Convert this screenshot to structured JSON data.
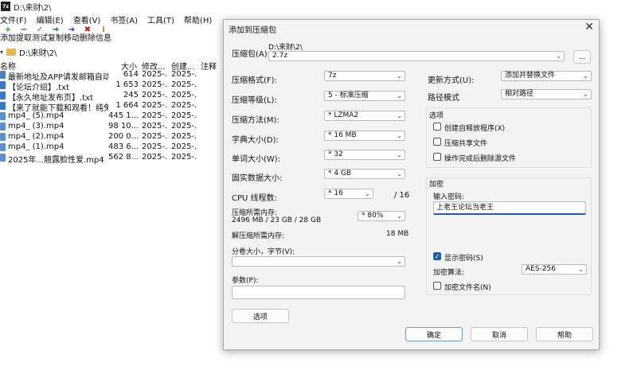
{
  "main": {
    "title": "D:\\来财\\2\\",
    "menu": [
      "文件(F)",
      "编辑(E)",
      "查看(V)",
      "书签(A)",
      "工具(T)",
      "帮助(H)"
    ],
    "toolbar": [
      {
        "label": "添加",
        "icon": "+",
        "color": "#1a9a1a"
      },
      {
        "label": "提取",
        "icon": "−",
        "color": "#1a3fb0"
      },
      {
        "label": "测试",
        "icon": "✓",
        "color": "#2a8fa8"
      },
      {
        "label": "复制",
        "icon": "➔",
        "color": "#1a6a3a"
      },
      {
        "label": "移动",
        "icon": "➔",
        "color": "#1a3fb0"
      },
      {
        "label": "删除",
        "icon": "✖",
        "color": "#c01a1a"
      },
      {
        "label": "信息",
        "icon": "i",
        "color": "#b88a00"
      }
    ],
    "address": "D:\\来财\\2\\",
    "columns": {
      "name": "名称",
      "size": "大小",
      "modified": "修改...",
      "created": "创建...",
      "comment": "注释"
    },
    "files": [
      {
        "name": "最新地址及APP请发邮箱自动...",
        "size": "614",
        "modified": "2025-...",
        "created": "2025-...",
        "type": "doc"
      },
      {
        "name": "【论坛介绍】.txt",
        "size": "1 653",
        "modified": "2025-...",
        "created": "2025-...",
        "type": "txt"
      },
      {
        "name": "【永久地址发布页】.txt",
        "size": "245",
        "modified": "2025-...",
        "created": "2025-...",
        "type": "txt"
      },
      {
        "name": "【来了就能下载和观看！纯免...",
        "size": "1 664",
        "modified": "2025-...",
        "created": "2025-...",
        "type": "txt"
      },
      {
        "name": "mp4_ (5).mp4",
        "size": "445 1...",
        "modified": "2025-...",
        "created": "2025-...",
        "type": "mp4"
      },
      {
        "name": "mp4_ (3).mp4",
        "size": "98 10...",
        "modified": "2025-...",
        "created": "2025-...",
        "type": "mp4"
      },
      {
        "name": "mp4_ (2).mp4",
        "size": "200 0...",
        "modified": "2025-...",
        "created": "2025-...",
        "type": "mp4"
      },
      {
        "name": "mp4_ (1).mp4",
        "size": "483 6...",
        "modified": "2025-...",
        "created": "2025-...",
        "type": "mp4"
      },
      {
        "name": "2025年...翘露脸性爱.mp4",
        "size": "562 8...",
        "modified": "2025-...",
        "created": "2025-...",
        "type": "mp4"
      }
    ]
  },
  "dialog": {
    "title": "添加到压缩包",
    "close": "✕",
    "archive_label": "压缩包(A):",
    "archive_path": "D:\\来财\\2\\",
    "archive_name": "2.7z",
    "browse": "...",
    "format_label": "压缩格式(F):",
    "format_value": "7z",
    "level_label": "压缩等级(L):",
    "level_value": "5 - 标准压缩",
    "method_label": "压缩方法(M):",
    "method_value": "*  LZMA2",
    "dict_label": "字典大小(D):",
    "dict_value": "*  16 MB",
    "word_label": "单词大小(W):",
    "word_value": "*  32",
    "solid_label": "固实数据大小:",
    "solid_value": "*  4 GB",
    "cpu_label": "CPU 线程数:",
    "cpu_value": "*  16",
    "cpu_total": "/ 16",
    "mem_label": "压缩所需内存:",
    "mem_detail": "2496 MB / 23 GB / 28 GB",
    "mem_percent": "* 80%",
    "demem_label": "解压缩所需内存:",
    "demem_value": "18 MB",
    "split_label": "分卷大小，字节(V):",
    "split_value": "",
    "params_label": "参数(P):",
    "params_value": "",
    "options_button": "选项",
    "update_label": "更新方式(U):",
    "update_value": "添加并替换文件",
    "path_label": "路径模式",
    "path_value": "相对路径",
    "options_group": "选项",
    "opt_sfx": "创建自释放程序(X)",
    "opt_shared": "压缩共享文件",
    "opt_delete": "操作完成后删除源文件",
    "encrypt_group": "加密",
    "password_label": "输入密码:",
    "password_value": "上老王论坛当老王",
    "show_password": "显示密码(S)",
    "enc_method_label": "加密算法:",
    "enc_method_value": "AES-256",
    "encrypt_names": "加密文件名(N)",
    "ok": "确定",
    "cancel": "取消",
    "help": "帮助"
  }
}
